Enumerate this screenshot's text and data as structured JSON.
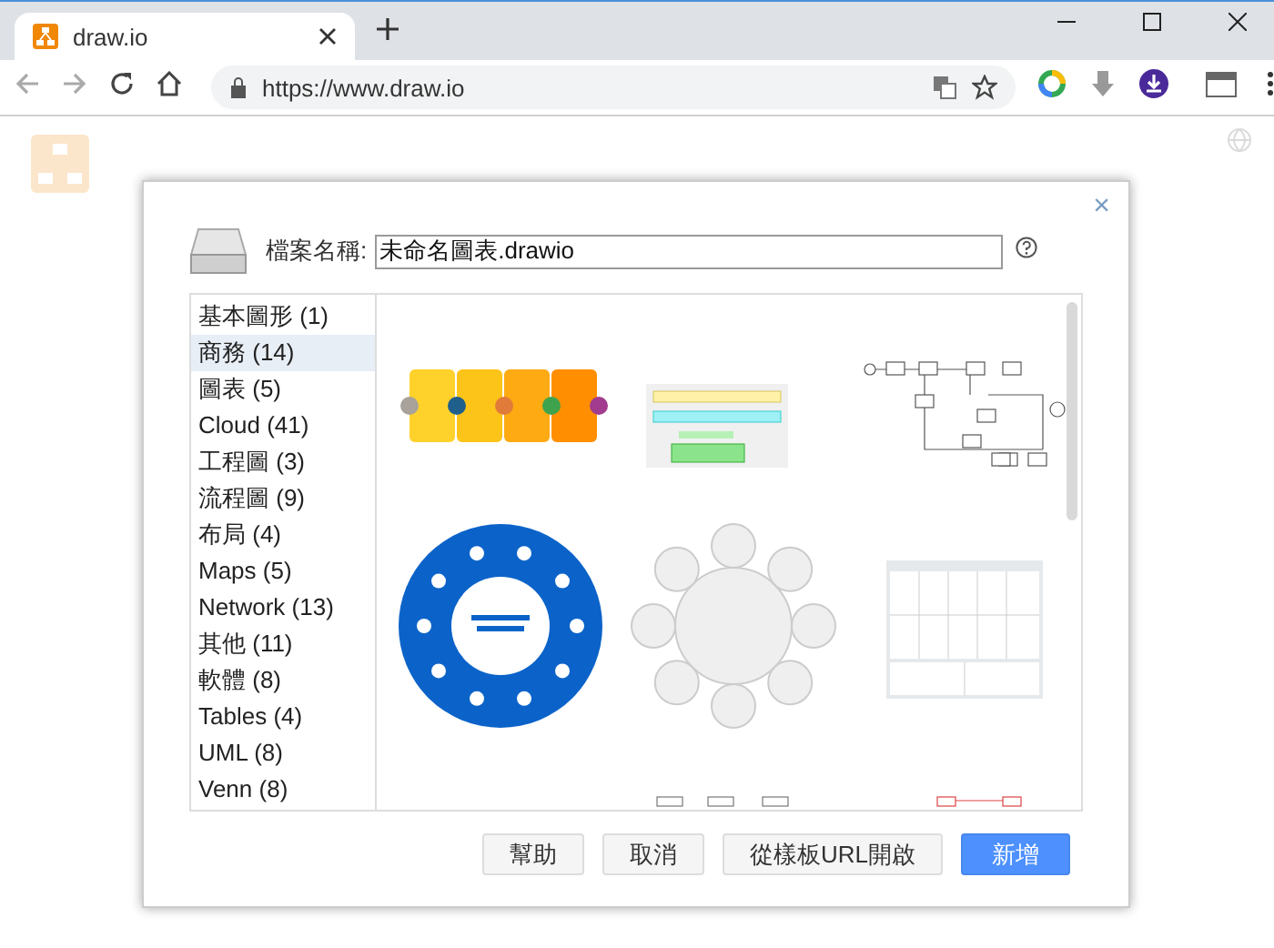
{
  "browser": {
    "tab_title": "draw.io",
    "url": "https://www.draw.io"
  },
  "dialog": {
    "close": "×",
    "filename_label": "檔案名稱:",
    "filename": "未命名圖表.drawio",
    "categories": [
      {
        "label": "基本圖形 (1)",
        "selected": false
      },
      {
        "label": "商務 (14)",
        "selected": true
      },
      {
        "label": "圖表 (5)",
        "selected": false
      },
      {
        "label": "Cloud (41)",
        "selected": false
      },
      {
        "label": "工程圖 (3)",
        "selected": false
      },
      {
        "label": "流程圖 (9)",
        "selected": false
      },
      {
        "label": "布局 (4)",
        "selected": false
      },
      {
        "label": "Maps (5)",
        "selected": false
      },
      {
        "label": "Network (13)",
        "selected": false
      },
      {
        "label": "其他 (11)",
        "selected": false
      },
      {
        "label": "軟體 (8)",
        "selected": false
      },
      {
        "label": "Tables (4)",
        "selected": false
      },
      {
        "label": "UML (8)",
        "selected": false
      },
      {
        "label": "Venn (8)",
        "selected": false
      }
    ],
    "templates": [
      {
        "kind": "steps"
      },
      {
        "kind": "swimlane"
      },
      {
        "kind": "flow"
      },
      {
        "kind": "ring"
      },
      {
        "kind": "cycle"
      },
      {
        "kind": "canvas"
      },
      {
        "kind": "boxes"
      },
      {
        "kind": "redbox"
      }
    ],
    "buttons": [
      {
        "label": "幫助",
        "kind": "plain"
      },
      {
        "label": "取消",
        "kind": "plain"
      },
      {
        "label": "從樣板URL開啟",
        "kind": "plain"
      },
      {
        "label": "新增",
        "kind": "primary"
      }
    ]
  }
}
